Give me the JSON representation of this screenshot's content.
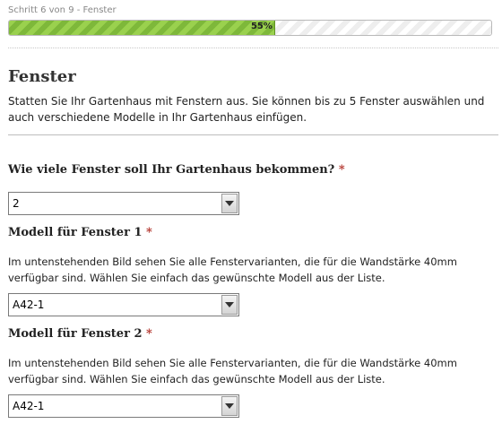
{
  "progress": {
    "step_label": "Schritt 6 von 9 - Fenster",
    "percent": 55,
    "percent_label": "55%"
  },
  "section": {
    "title": "Fenster",
    "description": "Statten Sie Ihr Gartenhaus mit Fenstern aus. Sie können bis zu 5 Fenster auswählen und auch verschiedene Modelle in Ihr Gartenhaus einfügen."
  },
  "questions": {
    "count": {
      "label": "Wie viele Fenster soll Ihr Gartenhaus bekommen?",
      "required_mark": "*",
      "value": "2"
    },
    "model1": {
      "label": "Modell für Fenster 1",
      "required_mark": "*",
      "help_line1": "Im untenstehenden Bild sehen Sie alle Fenstervarianten, die für die Wandstärke 40mm",
      "help_line2": "verfügbar sind. Wählen Sie einfach das gewünschte Modell aus der Liste.",
      "value": "A42-1"
    },
    "model2": {
      "label": "Modell für Fenster 2",
      "required_mark": "*",
      "help_line1": "Im untenstehenden Bild sehen Sie alle Fenstervarianten, die für die Wandstärke 40mm",
      "help_line2": "verfügbar sind. Wählen Sie einfach das gewünschte Modell aus der Liste.",
      "value": "A42-1"
    }
  },
  "colors": {
    "progress_green": "#8cc544",
    "required_red": "#b3362e"
  }
}
